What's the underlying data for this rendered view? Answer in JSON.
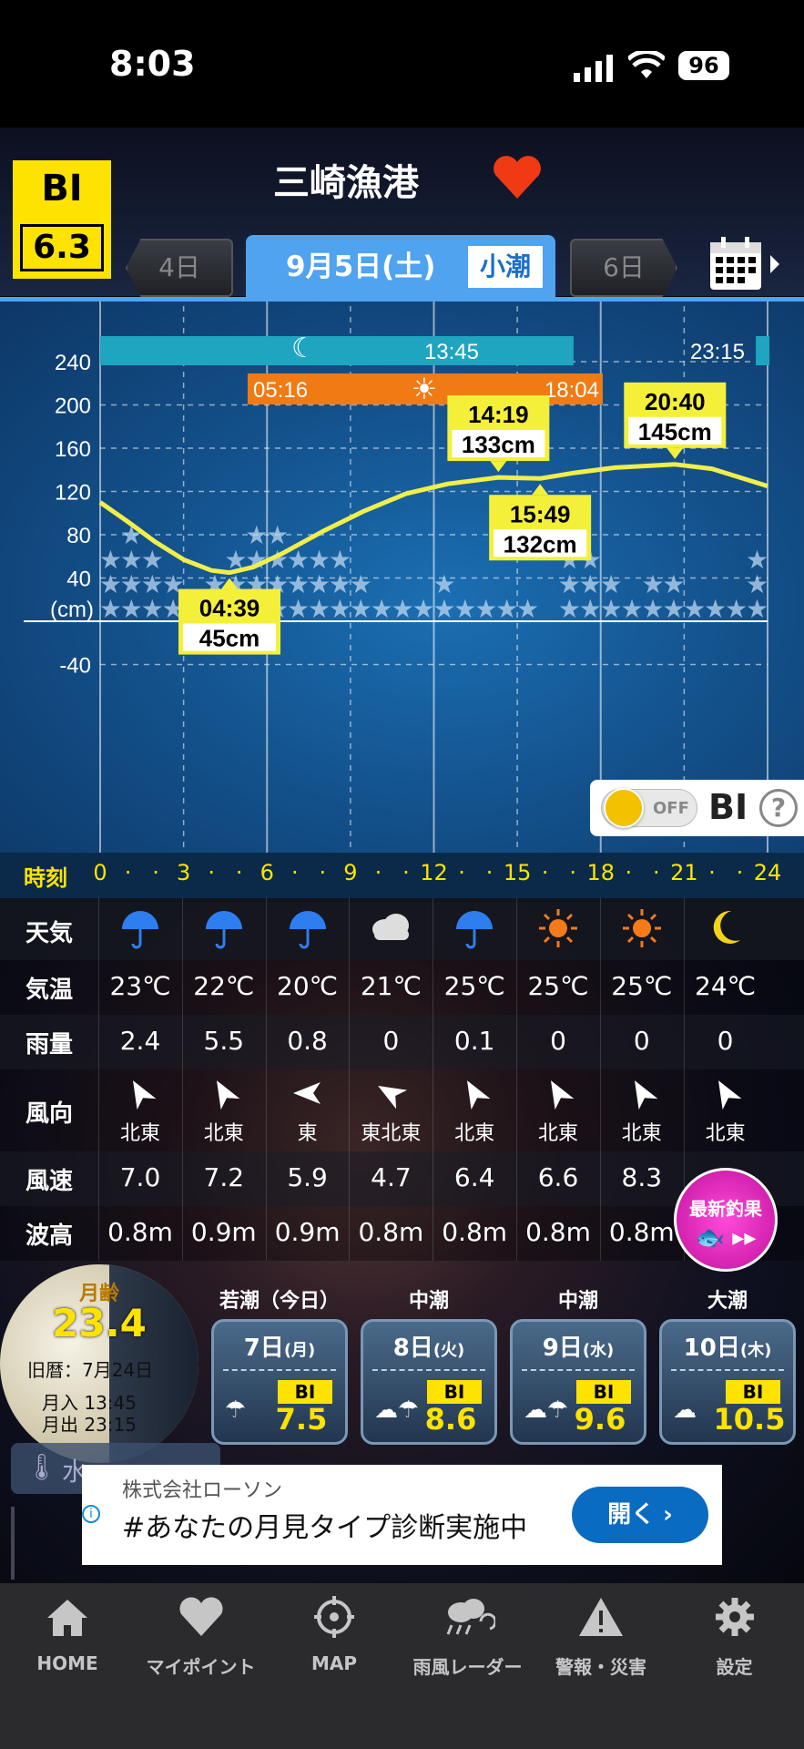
{
  "status": {
    "time": "8:03",
    "battery": "96"
  },
  "header": {
    "bi_label": "BI",
    "bi_value": "6.3",
    "title": "三崎漁港",
    "prev_tab": "4日",
    "current_tab": "9月5日(土)",
    "current_tide": "小潮",
    "next_tab": "6日"
  },
  "sun_moon": {
    "moon_set": "13:45",
    "moon_rise": "23:15",
    "sunrise": "05:16",
    "sunset": "18:04"
  },
  "chart_data": {
    "type": "line",
    "ylabel": "(cm)",
    "yticks": [
      "240",
      "200",
      "160",
      "120",
      "80",
      "40",
      "-40"
    ],
    "ylim": [
      -60,
      260
    ],
    "xlim": [
      0,
      24
    ],
    "series": [
      {
        "x": [
          0,
          1,
          2,
          3,
          4,
          4.65,
          5.5,
          6.5,
          8,
          9.5,
          11,
          12.5,
          14.32,
          15.82,
          17,
          18.5,
          20.67,
          22,
          23,
          24
        ],
        "values": [
          110,
          92,
          73,
          57,
          47,
          45,
          50,
          62,
          83,
          102,
          118,
          127,
          133,
          132,
          137,
          142,
          145,
          141,
          133,
          125
        ]
      }
    ],
    "annotations": [
      {
        "time": "04:39",
        "height": "45cm",
        "x": 4.65,
        "y": 45
      },
      {
        "time": "14:19",
        "height": "133cm",
        "x": 14.32,
        "y": 133
      },
      {
        "time": "15:49",
        "height": "132cm",
        "x": 15.82,
        "y": 132
      },
      {
        "time": "20:40",
        "height": "145cm",
        "x": 20.67,
        "y": 145
      }
    ],
    "bi_stars": [
      3,
      4,
      3,
      2,
      1,
      2,
      3,
      4,
      4,
      3,
      3,
      3,
      2,
      1,
      1,
      1,
      2,
      1,
      1,
      1,
      1,
      0,
      3,
      3,
      2,
      1,
      2,
      2,
      1,
      1,
      1,
      3
    ]
  },
  "bi_toggle": {
    "state": "OFF",
    "label": "BI",
    "help": "?"
  },
  "timebar": {
    "label": "時刻",
    "ticks": [
      "0",
      "3",
      "6",
      "9",
      "12",
      "15",
      "18",
      "21",
      "24"
    ]
  },
  "weather": {
    "rows": {
      "weather": "天気",
      "temp": "気温",
      "rain": "雨量",
      "wind_dir": "風向",
      "wind_speed": "風速",
      "wave": "波高"
    },
    "icons": [
      "umbrella",
      "umbrella",
      "umbrella",
      "cloud",
      "umbrella",
      "sun",
      "sun",
      "moon"
    ],
    "temps": [
      "23℃",
      "22℃",
      "20℃",
      "21℃",
      "25℃",
      "25℃",
      "25℃",
      "24℃"
    ],
    "rain": [
      "2.4",
      "5.5",
      "0.8",
      "0",
      "0.1",
      "0",
      "0",
      "0"
    ],
    "dirs": [
      "北東",
      "北東",
      "東",
      "東北東",
      "北東",
      "北東",
      "北東",
      "北東"
    ],
    "speeds": [
      "7.0",
      "7.2",
      "5.9",
      "4.7",
      "6.4",
      "6.6",
      "8.3",
      ""
    ],
    "waves": [
      "0.8m",
      "0.9m",
      "0.9m",
      "0.8m",
      "0.8m",
      "0.8m",
      "0.8m",
      ""
    ],
    "fish_button": "最新釣果"
  },
  "moon": {
    "label": "月齢",
    "age": "23.4",
    "lunar": "旧暦：7月24日",
    "rise": "月入 13:45",
    "set": "月出 23:15"
  },
  "days": [
    {
      "tide": "若潮（今日）",
      "day": "7日",
      "dow": "(月)",
      "bi": "7.5"
    },
    {
      "tide": "中潮",
      "day": "8日",
      "dow": "(火)",
      "bi": "8.6"
    },
    {
      "tide": "中潮",
      "day": "9日",
      "dow": "(水)",
      "bi": "9.6"
    },
    {
      "tide": "大潮",
      "day": "10日",
      "dow": "(木)",
      "bi": "10.5"
    }
  ],
  "water_temp_partial": "水",
  "ad": {
    "company": "株式会社ローソン",
    "text": "#あなたの月見タイプ診断実施中",
    "button": "開く"
  },
  "tabbar": [
    "HOME",
    "マイポイント",
    "MAP",
    "雨風レーダー",
    "警報・災害",
    "設定"
  ]
}
